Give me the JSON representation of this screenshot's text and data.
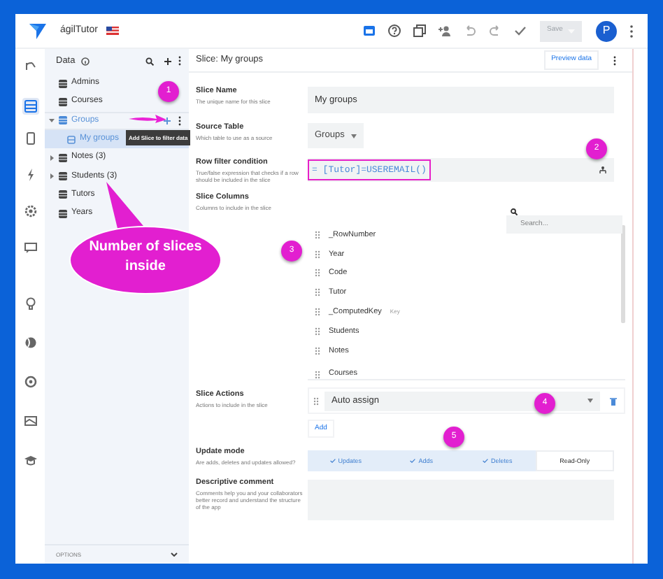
{
  "app": {
    "title": "ágilTutor"
  },
  "toolbar": {
    "save_label": "Save",
    "avatar": "P"
  },
  "data_panel": {
    "title": "Data",
    "tables": [
      {
        "label": "Admins",
        "kind": "plain",
        "expanded": false,
        "selected": false
      },
      {
        "label": "Courses",
        "kind": "plain",
        "expanded": false,
        "selected": false
      },
      {
        "label": "Groups",
        "kind": "with-slices",
        "expanded": true,
        "selected": false,
        "children": [
          {
            "label": "My groups",
            "selected": true
          }
        ]
      },
      {
        "label": "Notes (3)",
        "kind": "with-slices",
        "expanded": false,
        "selected": false
      },
      {
        "label": "Students (3)",
        "kind": "with-slices",
        "expanded": false,
        "selected": false
      },
      {
        "label": "Tutors",
        "kind": "plain",
        "expanded": false,
        "selected": false
      },
      {
        "label": "Years",
        "kind": "plain",
        "expanded": false,
        "selected": false
      }
    ],
    "footer": "OPTIONS"
  },
  "slice": {
    "header": "Slice: My groups",
    "preview_button": "Preview data",
    "name": {
      "label": "Slice Name",
      "hint": "The unique name for this slice",
      "value": "My groups"
    },
    "source_table": {
      "label": "Source Table",
      "hint": "Which table to use as a source",
      "value": "Groups"
    },
    "row_filter": {
      "label": "Row filter condition",
      "hint": "True/false expression that checks if a row should be included in the slice",
      "value": "= [Tutor]=USEREMAIL()"
    },
    "columns": {
      "label": "Slice Columns",
      "hint": "Columns to include in the slice",
      "search_placeholder": "Search...",
      "items": [
        {
          "label": "_RowNumber"
        },
        {
          "label": "Year"
        },
        {
          "label": "Code"
        },
        {
          "label": "Tutor"
        },
        {
          "label": "_ComputedKey",
          "tag": "Key"
        },
        {
          "label": "Students"
        },
        {
          "label": "Notes"
        },
        {
          "label": "Courses"
        }
      ]
    },
    "actions": {
      "label": "Slice Actions",
      "hint": "Actions to include in the slice",
      "items": [
        {
          "value": "Auto assign"
        }
      ],
      "add_button": "Add"
    },
    "update_mode": {
      "label": "Update mode",
      "hint": "Are adds, deletes and updates allowed?",
      "options": [
        {
          "label": "Updates",
          "selected": true
        },
        {
          "label": "Adds",
          "selected": true
        },
        {
          "label": "Deletes",
          "selected": true
        },
        {
          "label": "Read-Only",
          "selected": false
        }
      ]
    },
    "comment": {
      "label": "Descriptive comment",
      "hint": "Comments help you and your collaborators better record and understand the structure of the app"
    }
  },
  "annotations": {
    "markers": [
      "1",
      "2",
      "3",
      "4",
      "5"
    ],
    "tooltip": "Add Slice to filter data",
    "callout": "Number of slices inside"
  }
}
